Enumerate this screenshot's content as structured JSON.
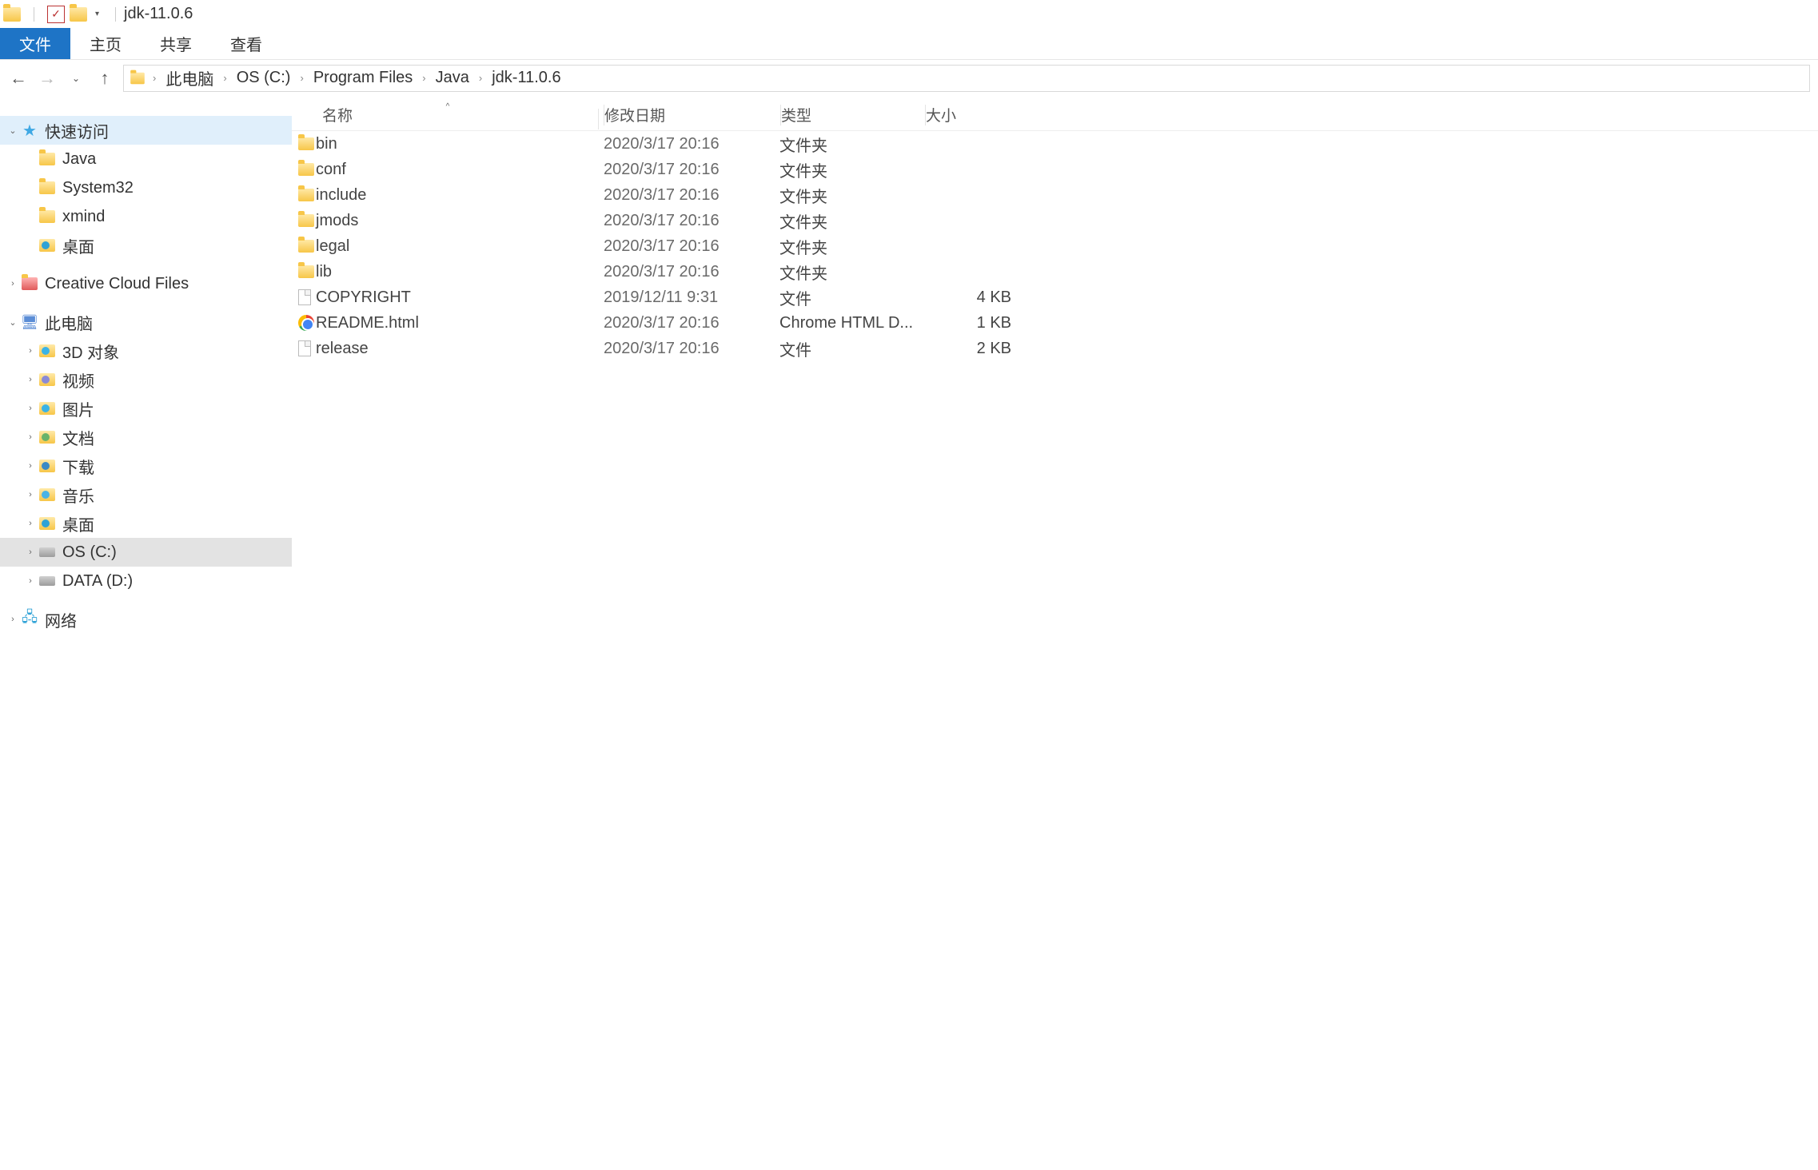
{
  "window": {
    "title": "jdk-11.0.6"
  },
  "ribbon": {
    "file": "文件",
    "home": "主页",
    "share": "共享",
    "view": "查看"
  },
  "breadcrumb": [
    "此电脑",
    "OS (C:)",
    "Program Files",
    "Java",
    "jdk-11.0.6"
  ],
  "tree": {
    "quick_access": "快速访问",
    "quick_items": [
      "Java",
      "System32",
      "xmind",
      "桌面"
    ],
    "creative_cloud": "Creative Cloud Files",
    "this_pc": "此电脑",
    "pc_items": [
      "3D 对象",
      "视频",
      "图片",
      "文档",
      "下载",
      "音乐",
      "桌面",
      "OS (C:)",
      "DATA (D:)"
    ],
    "network": "网络"
  },
  "columns": {
    "name": "名称",
    "date": "修改日期",
    "type": "类型",
    "size": "大小"
  },
  "files": [
    {
      "name": "bin",
      "date": "2020/3/17 20:16",
      "type": "文件夹",
      "size": "",
      "icon": "folder"
    },
    {
      "name": "conf",
      "date": "2020/3/17 20:16",
      "type": "文件夹",
      "size": "",
      "icon": "folder"
    },
    {
      "name": "include",
      "date": "2020/3/17 20:16",
      "type": "文件夹",
      "size": "",
      "icon": "folder"
    },
    {
      "name": "jmods",
      "date": "2020/3/17 20:16",
      "type": "文件夹",
      "size": "",
      "icon": "folder"
    },
    {
      "name": "legal",
      "date": "2020/3/17 20:16",
      "type": "文件夹",
      "size": "",
      "icon": "folder"
    },
    {
      "name": "lib",
      "date": "2020/3/17 20:16",
      "type": "文件夹",
      "size": "",
      "icon": "folder"
    },
    {
      "name": "COPYRIGHT",
      "date": "2019/12/11 9:31",
      "type": "文件",
      "size": "4 KB",
      "icon": "file"
    },
    {
      "name": "README.html",
      "date": "2020/3/17 20:16",
      "type": "Chrome HTML D...",
      "size": "1 KB",
      "icon": "chrome"
    },
    {
      "name": "release",
      "date": "2020/3/17 20:16",
      "type": "文件",
      "size": "2 KB",
      "icon": "file"
    }
  ]
}
